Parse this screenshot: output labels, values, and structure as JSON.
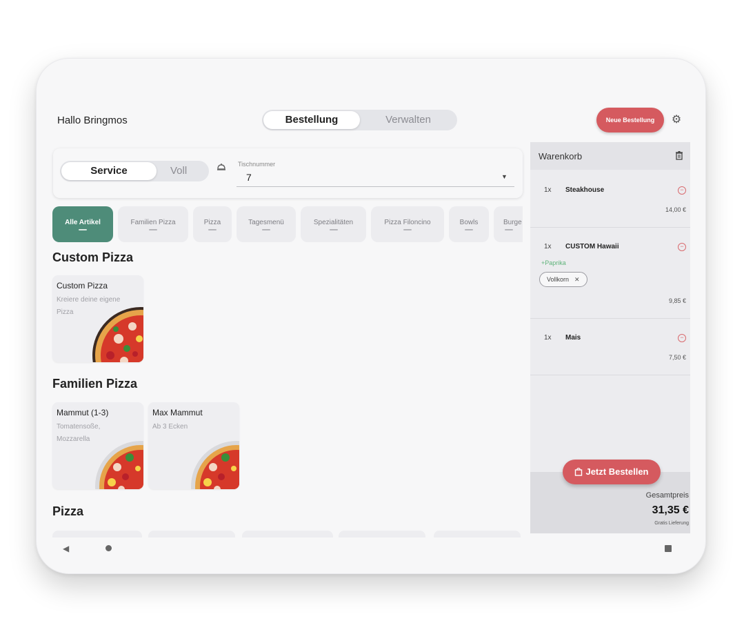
{
  "header": {
    "greeting": "Hallo Bringmos",
    "tabs": [
      {
        "label": "Bestellung",
        "active": true
      },
      {
        "label": "Verwalten",
        "active": false
      }
    ],
    "new_order_label": "Neue Bestellung",
    "settings_icon": "gear-icon"
  },
  "order_options": {
    "mode_active": "Service",
    "mode_inactive": "Voll",
    "table_label": "Tischnummer",
    "table_value": "7"
  },
  "categories": [
    {
      "label": "Alle Artikel",
      "active": true
    },
    {
      "label": "Familien Pizza"
    },
    {
      "label": "Pizza"
    },
    {
      "label": "Tagesmenü"
    },
    {
      "label": "Spezialitäten"
    },
    {
      "label": "Pizza Filoncino"
    },
    {
      "label": "Bowls"
    },
    {
      "label": "Burge"
    }
  ],
  "sections": [
    {
      "title": "Custom Pizza",
      "items": [
        {
          "name": "Custom Pizza",
          "desc": "Kreiere deine eigene Pizza"
        }
      ]
    },
    {
      "title": "Familien Pizza",
      "items": [
        {
          "name": "Mammut (1-3)",
          "desc": "Tomatensoße, Mozzarella"
        },
        {
          "name": "Max Mammut",
          "desc": "Ab 3 Ecken"
        }
      ]
    },
    {
      "title": "Pizza",
      "items": []
    }
  ],
  "cart": {
    "title": "Warenkorb",
    "items": [
      {
        "qty": "1x",
        "name": "Steakhouse",
        "price": "14,00 €"
      },
      {
        "qty": "1x",
        "name": "CUSTOM Hawaii",
        "extra": "+Paprika",
        "tag": "Vollkorn",
        "price": "9,85 €"
      },
      {
        "qty": "1x",
        "name": "Mais",
        "price": "7,50 €"
      }
    ],
    "order_button": "Jetzt Bestellen",
    "total_label": "Gesamtpreis",
    "total_value": "31,35 €",
    "total_note": "Gratis Lieferung"
  }
}
